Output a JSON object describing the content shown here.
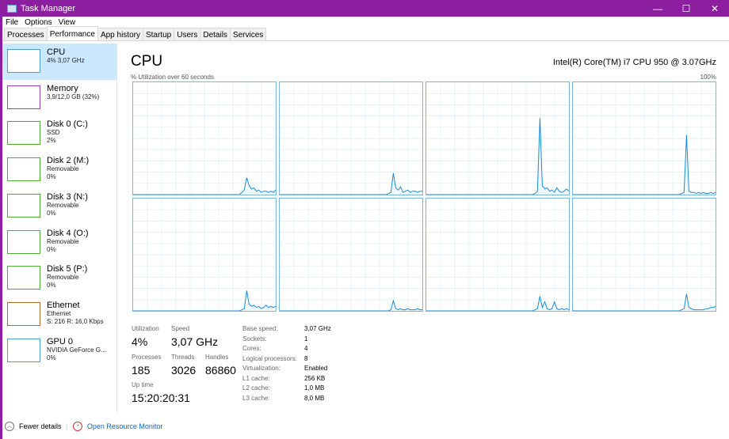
{
  "window": {
    "title": "Task Manager",
    "controls": [
      "—",
      "☐",
      "✕"
    ]
  },
  "menu": [
    "File",
    "Options",
    "View"
  ],
  "tabs": [
    "Processes",
    "Performance",
    "App history",
    "Startup",
    "Users",
    "Details",
    "Services"
  ],
  "active_tab": "Performance",
  "sidebar": [
    {
      "title": "CPU",
      "l1": "4% 3,07 GHz",
      "l2": "",
      "l3": "",
      "color": "#4d9fd9"
    },
    {
      "title": "Memory",
      "l1": "3,9/12,0 GB (32%)",
      "l2": "",
      "l3": "",
      "color": "#9b3fbf"
    },
    {
      "title": "Disk 0 (C:)",
      "l1": "SSD",
      "l2": "2%",
      "l3": "",
      "color": "#4caf2f"
    },
    {
      "title": "Disk 2 (M:)",
      "l1": "Removable",
      "l2": "0%",
      "l3": "",
      "color": "#4caf2f"
    },
    {
      "title": "Disk 3 (N:)",
      "l1": "Removable",
      "l2": "0%",
      "l3": "",
      "color": "#4caf2f"
    },
    {
      "title": "Disk 4 (O:)",
      "l1": "Removable",
      "l2": "0%",
      "l3": "",
      "color": "#4caf2f"
    },
    {
      "title": "Disk 5 (P:)",
      "l1": "Removable",
      "l2": "0%",
      "l3": "",
      "color": "#4caf2f"
    },
    {
      "title": "Ethernet",
      "l1": "Ethernet",
      "l2": "S: 216 R: 16,0 Kbps",
      "l3": "",
      "color": "#b56a2b"
    },
    {
      "title": "GPU 0",
      "l1": "NVIDIA GeForce G...",
      "l2": "0%",
      "l3": "",
      "color": "#4d9fd9"
    }
  ],
  "main": {
    "title": "CPU",
    "model": "Intel(R) Core(TM) i7 CPU 950 @ 3.07GHz",
    "graph_label": "% Utilization over 60 seconds",
    "graph_max": "100%",
    "cores": [
      [
        0,
        0,
        0,
        0,
        0,
        0,
        0,
        0,
        0,
        0,
        0,
        0,
        0,
        0,
        0,
        0,
        0,
        0,
        0,
        0,
        0,
        0,
        0,
        0,
        0,
        0,
        0,
        0,
        0,
        0,
        0,
        0,
        0,
        0,
        0,
        0,
        0,
        0,
        0,
        0,
        0,
        0,
        0,
        0,
        0,
        2,
        4,
        15,
        8,
        5,
        6,
        3,
        4,
        2,
        3,
        3,
        2,
        3,
        2,
        4
      ],
      [
        0,
        0,
        0,
        0,
        0,
        0,
        0,
        0,
        0,
        0,
        0,
        0,
        0,
        0,
        0,
        0,
        0,
        0,
        0,
        0,
        0,
        0,
        0,
        0,
        0,
        0,
        0,
        0,
        0,
        0,
        0,
        0,
        0,
        0,
        0,
        0,
        0,
        0,
        0,
        0,
        0,
        0,
        0,
        0,
        0,
        1,
        2,
        19,
        6,
        4,
        7,
        2,
        3,
        4,
        2,
        3,
        3,
        2,
        3,
        3
      ],
      [
        0,
        0,
        0,
        0,
        0,
        0,
        0,
        0,
        0,
        0,
        0,
        0,
        0,
        0,
        0,
        0,
        0,
        0,
        0,
        0,
        0,
        0,
        0,
        0,
        0,
        0,
        0,
        0,
        0,
        0,
        0,
        0,
        0,
        0,
        0,
        0,
        0,
        0,
        0,
        0,
        0,
        0,
        0,
        0,
        0,
        1,
        3,
        68,
        8,
        5,
        6,
        3,
        4,
        2,
        6,
        3,
        2,
        3,
        5,
        3
      ],
      [
        0,
        0,
        0,
        0,
        0,
        0,
        0,
        0,
        0,
        0,
        0,
        0,
        0,
        0,
        0,
        0,
        0,
        0,
        0,
        0,
        0,
        0,
        0,
        0,
        0,
        0,
        0,
        0,
        0,
        0,
        0,
        0,
        0,
        0,
        0,
        0,
        0,
        0,
        0,
        0,
        0,
        0,
        0,
        0,
        0,
        1,
        2,
        53,
        3,
        2,
        2,
        1,
        2,
        1,
        2,
        1,
        1,
        2,
        1,
        2
      ],
      [
        0,
        0,
        0,
        0,
        0,
        0,
        0,
        0,
        0,
        0,
        0,
        0,
        0,
        0,
        0,
        0,
        0,
        0,
        0,
        0,
        0,
        0,
        0,
        0,
        0,
        0,
        0,
        0,
        0,
        0,
        0,
        0,
        0,
        0,
        0,
        0,
        0,
        0,
        0,
        0,
        0,
        0,
        0,
        0,
        0,
        1,
        2,
        18,
        6,
        4,
        5,
        3,
        4,
        2,
        3,
        5,
        3,
        4,
        3,
        4
      ],
      [
        0,
        0,
        0,
        0,
        0,
        0,
        0,
        0,
        0,
        0,
        0,
        0,
        0,
        0,
        0,
        0,
        0,
        0,
        0,
        0,
        0,
        0,
        0,
        0,
        0,
        0,
        0,
        0,
        0,
        0,
        0,
        0,
        0,
        0,
        0,
        0,
        0,
        0,
        0,
        0,
        0,
        0,
        0,
        0,
        0,
        0,
        1,
        9,
        2,
        1,
        2,
        1,
        1,
        2,
        1,
        1,
        1,
        2,
        1,
        1
      ],
      [
        0,
        0,
        0,
        0,
        0,
        0,
        0,
        0,
        0,
        0,
        0,
        0,
        0,
        0,
        0,
        0,
        0,
        0,
        0,
        0,
        0,
        0,
        0,
        0,
        0,
        0,
        0,
        0,
        0,
        0,
        0,
        0,
        0,
        0,
        0,
        0,
        0,
        0,
        0,
        0,
        0,
        0,
        0,
        0,
        0,
        1,
        2,
        13,
        3,
        8,
        2,
        1,
        2,
        8,
        2,
        1,
        2,
        1,
        2,
        1
      ],
      [
        0,
        0,
        0,
        0,
        0,
        0,
        0,
        0,
        0,
        0,
        0,
        0,
        0,
        0,
        0,
        0,
        0,
        0,
        0,
        0,
        0,
        0,
        0,
        0,
        0,
        0,
        0,
        0,
        0,
        0,
        0,
        0,
        0,
        0,
        0,
        0,
        0,
        0,
        0,
        0,
        0,
        0,
        0,
        0,
        0,
        1,
        2,
        15,
        3,
        2,
        1,
        1,
        1,
        1,
        1,
        2,
        2,
        3,
        3,
        4
      ]
    ],
    "stats": {
      "utilization_label": "Utilization",
      "utilization": "4%",
      "speed_label": "Speed",
      "speed": "3,07 GHz",
      "processes_label": "Processes",
      "processes": "185",
      "threads_label": "Threads",
      "threads": "3026",
      "handles_label": "Handles",
      "handles": "86860",
      "uptime_label": "Up time",
      "uptime": "15:20:20:31"
    },
    "details": [
      [
        "Base speed:",
        "3,07 GHz"
      ],
      [
        "Sockets:",
        "1"
      ],
      [
        "Cores:",
        "4"
      ],
      [
        "Logical processors:",
        "8"
      ],
      [
        "Virtualization:",
        "Enabled"
      ],
      [
        "L1 cache:",
        "256 KB"
      ],
      [
        "L2 cache:",
        "1,0 MB"
      ],
      [
        "L3 cache:",
        "8,0 MB"
      ]
    ]
  },
  "footer": {
    "fewer": "Fewer details",
    "monitor": "Open Resource Monitor"
  }
}
